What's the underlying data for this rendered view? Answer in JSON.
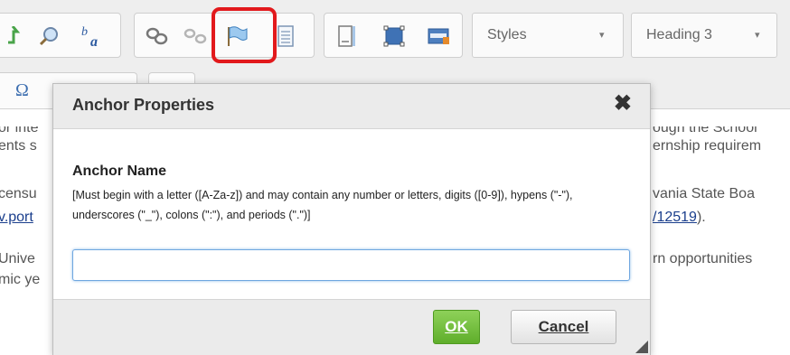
{
  "toolbar": {
    "styles_combo": "Styles",
    "format_combo": "Heading 3",
    "combo_arrow": "▾",
    "omega_glyph": "Ω",
    "icons": [
      "replace-icon",
      "find-icon",
      "spellcheck-icon",
      "link-icon",
      "unlink-icon",
      "anchor-flag-icon",
      "document-icon",
      "div-container-icon",
      "select-all-icon",
      "html-block-icon"
    ]
  },
  "document": {
    "line1_left": "or inte",
    "line1_right": "ough the School",
    "line2_left": "ents s",
    "line2_right": "ernship requirem",
    "line3_left": "censu",
    "line3_right": "vania State Boa",
    "line4_left": "v.port",
    "line4_right_link": "/12519",
    "line4_right_tail": ").",
    "line5_left": "Unive",
    "line5_right": "rn opportunities",
    "line6_left": "mic ye"
  },
  "dialog": {
    "title": "Anchor Properties",
    "close_glyph": "✖",
    "field_label": "Anchor Name",
    "field_hint": "[Must begin with a letter ([A-Za-z]) and may contain any number or letters, digits ([0-9]), hypens (\"-\"), underscores (\"_\"), colons (\":\"), and periods (\".\")]",
    "input_value": "",
    "ok_label": "OK",
    "cancel_label": "Cancel"
  },
  "colors": {
    "highlight": "#e2191c",
    "ok_button": "#6cbd35",
    "input_focus": "#6fa7e0",
    "link": "#1a3e8c"
  }
}
